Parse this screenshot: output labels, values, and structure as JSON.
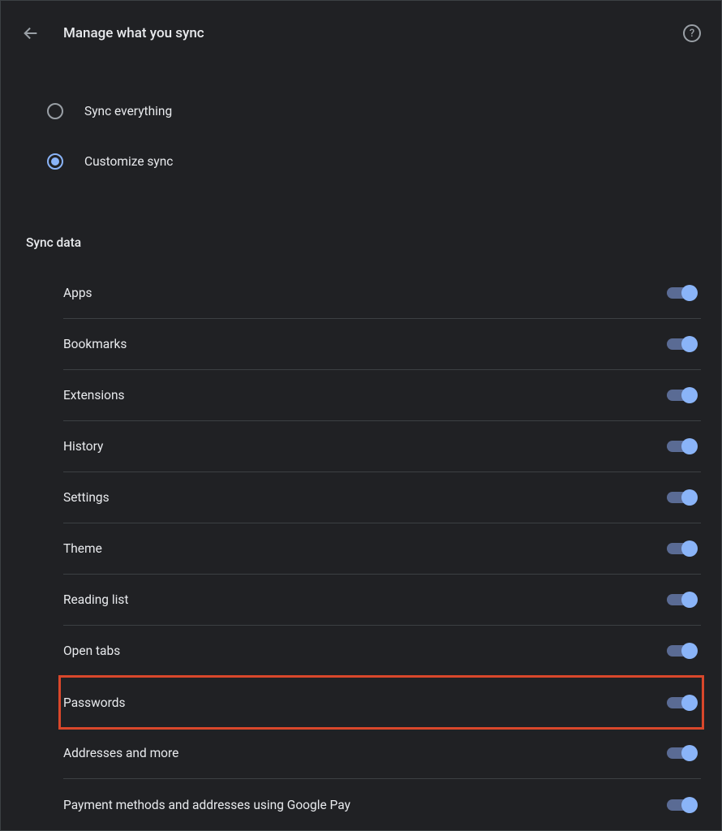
{
  "header": {
    "title": "Manage what you sync"
  },
  "radio_options": [
    {
      "label": "Sync everything",
      "selected": false
    },
    {
      "label": "Customize sync",
      "selected": true
    }
  ],
  "section_title": "Sync data",
  "toggles": [
    {
      "label": "Apps",
      "on": true,
      "highlighted": false
    },
    {
      "label": "Bookmarks",
      "on": true,
      "highlighted": false
    },
    {
      "label": "Extensions",
      "on": true,
      "highlighted": false
    },
    {
      "label": "History",
      "on": true,
      "highlighted": false
    },
    {
      "label": "Settings",
      "on": true,
      "highlighted": false
    },
    {
      "label": "Theme",
      "on": true,
      "highlighted": false
    },
    {
      "label": "Reading list",
      "on": true,
      "highlighted": false
    },
    {
      "label": "Open tabs",
      "on": true,
      "highlighted": false
    },
    {
      "label": "Passwords",
      "on": true,
      "highlighted": true
    },
    {
      "label": "Addresses and more",
      "on": true,
      "highlighted": false
    },
    {
      "label": "Payment methods and addresses using Google Pay",
      "on": true,
      "highlighted": false
    }
  ]
}
